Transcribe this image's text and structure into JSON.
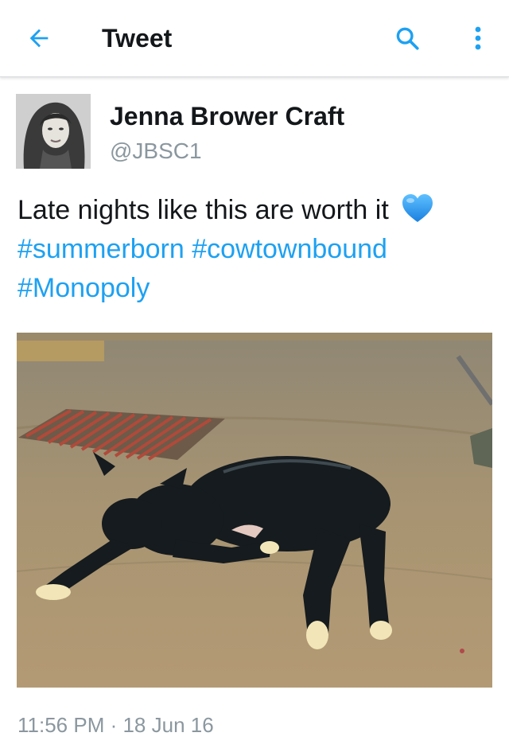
{
  "header": {
    "title": "Tweet",
    "back_icon": "arrow-left-icon",
    "search_icon": "search-icon",
    "more_icon": "overflow-menu-icon",
    "accent_color": "#1da1f2"
  },
  "tweet": {
    "author_name": "Jenna Brower Craft",
    "author_handle": "@JBSC1",
    "text_plain": "Late nights like this are worth it",
    "emoji": "blue-heart",
    "hashtags": [
      "#summerborn",
      "#cowtownbound",
      "#Monopoly"
    ],
    "timestamp": "11:56 PM · 18 Jun 16",
    "hashtag_color": "#1da1f2",
    "secondary_text_color": "#8b979f"
  }
}
